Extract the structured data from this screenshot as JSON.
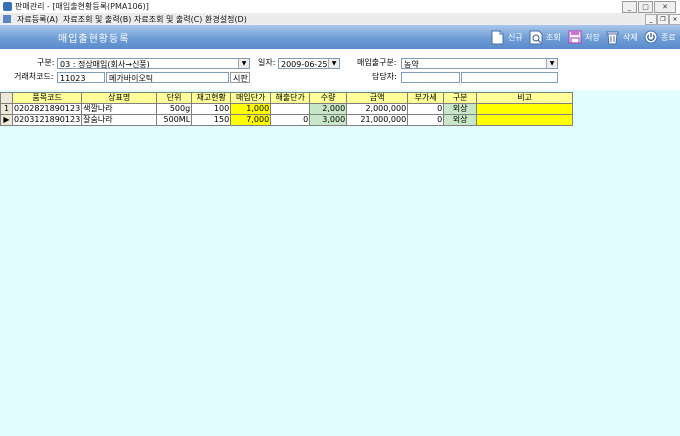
{
  "window": {
    "title": "판매관리 - [매입출현황등록(PMA106)]"
  },
  "menu": {
    "items": [
      "자료등록(A)",
      "자료조회 및 출력(B)",
      "자료조회 및 출력(C)",
      "환경설정(D)"
    ]
  },
  "header": {
    "title": "매입출현황등록"
  },
  "toolbar": {
    "new": "신규",
    "search": "조회",
    "save": "저장",
    "delete": "삭제",
    "exit": "종료"
  },
  "form": {
    "type_label": "구분:",
    "type_value": "03 : 정상매입(회사→신풍)",
    "date_label": "일자:",
    "date_value": "2009-06-25",
    "inout_label": "매입출구분:",
    "inout_value": "농약",
    "client_label": "거래처코드:",
    "client_code": "11023",
    "client_name": "메가바이오틱",
    "client_extra": "시판",
    "manager_label": "담당자:",
    "manager_code": "",
    "manager_name": ""
  },
  "grid": {
    "columns": [
      "품목코드",
      "상표명",
      "단위",
      "재고현황",
      "매입단가",
      "해출단가",
      "수량",
      "금액",
      "부가세",
      "구분",
      "비고"
    ],
    "rows": [
      {
        "marker": "1",
        "code": "0202821890123",
        "name": "색깔나라",
        "unit": "500g",
        "stock": "100",
        "buy_price": "1,000",
        "sell_price": "",
        "qty": "2,000",
        "amount": "2,000,000",
        "vat": "0",
        "kind": "외상",
        "note": ""
      },
      {
        "marker": "▶",
        "code": "0203121890123",
        "name": "잘숨나라",
        "unit": "500ML",
        "stock": "150",
        "buy_price": "7,000",
        "sell_price": "0",
        "qty": "3,000",
        "amount": "21,000,000",
        "vat": "0",
        "kind": "외상",
        "note": ""
      }
    ]
  }
}
